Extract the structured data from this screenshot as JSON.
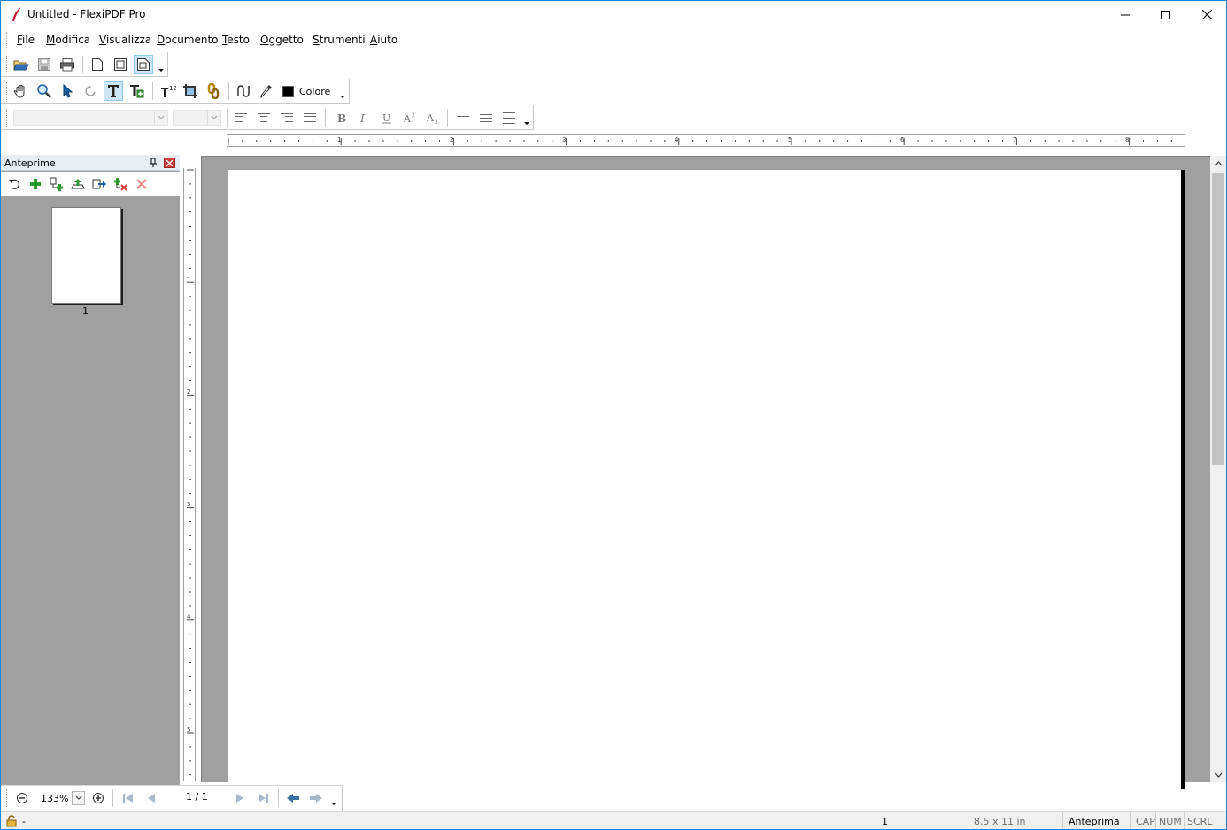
{
  "window": {
    "title": "Untitled - FlexiPDF Pro",
    "logo_icon": "flexipdf-logo-icon",
    "controls": [
      "minimize-icon",
      "maximize-icon",
      "close-icon"
    ]
  },
  "menu": {
    "items": [
      {
        "accel": "F",
        "rest": "ile"
      },
      {
        "accel": "M",
        "rest": "odifica"
      },
      {
        "accel": "V",
        "rest": "isualizza"
      },
      {
        "accel": "D",
        "rest": "ocumento"
      },
      {
        "accel": "T",
        "rest": "esto"
      },
      {
        "accel": "O",
        "rest": "ggetto"
      },
      {
        "accel": "S",
        "rest": "trumenti"
      },
      {
        "accel": "A",
        "rest": "iuto"
      }
    ]
  },
  "toolbar_file": {
    "buttons": [
      "open-folder-icon",
      "save-icon",
      "print-icon",
      "single-page-icon",
      "facing-pages-icon",
      "continuous-page-icon"
    ]
  },
  "toolbar_tools": {
    "buttons": [
      "hand-tool-icon",
      "zoom-tool-icon",
      "select-arrow-icon",
      "rotate-icon",
      "text-edit-icon",
      "text-frame-icon",
      "text-size-icon",
      "crop-icon",
      "link-icon",
      "curve-icon",
      "eyedropper-icon"
    ],
    "color_label": "Colore",
    "color_value": "#000000"
  },
  "toolbar_format": {
    "font_family": "",
    "font_size": "",
    "buttons": [
      "align-left-icon",
      "align-center-icon",
      "align-right-icon",
      "align-justify-icon",
      "bold-icon",
      "italic-icon",
      "underline-icon",
      "superscript-icon",
      "subscript-icon",
      "line-spacing-1-icon",
      "line-spacing-15-icon",
      "line-spacing-2-icon"
    ]
  },
  "rulers": {
    "horizontal_labels": [
      "1",
      "2",
      "3",
      "4",
      "5",
      "6",
      "7",
      "8"
    ],
    "vertical_labels": [
      "1",
      "2",
      "3",
      "4",
      "5"
    ]
  },
  "thumbnails_panel": {
    "title": "Anteprime",
    "buttons": [
      "undo-icon",
      "add-page-icon",
      "insert-pages-icon",
      "extract-icon",
      "export-icon",
      "delete-marked-icon",
      "delete-page-icon"
    ],
    "pages": [
      {
        "label": "1"
      }
    ]
  },
  "navigation": {
    "zoom": "133%",
    "page_indicator": "1 / 1"
  },
  "status": {
    "left_text": "-",
    "page": "1",
    "page_size": "8.5 x 11 in",
    "mode": "Anteprima",
    "cap": "CAP",
    "num": "NUM",
    "scrl": "SCRL"
  }
}
